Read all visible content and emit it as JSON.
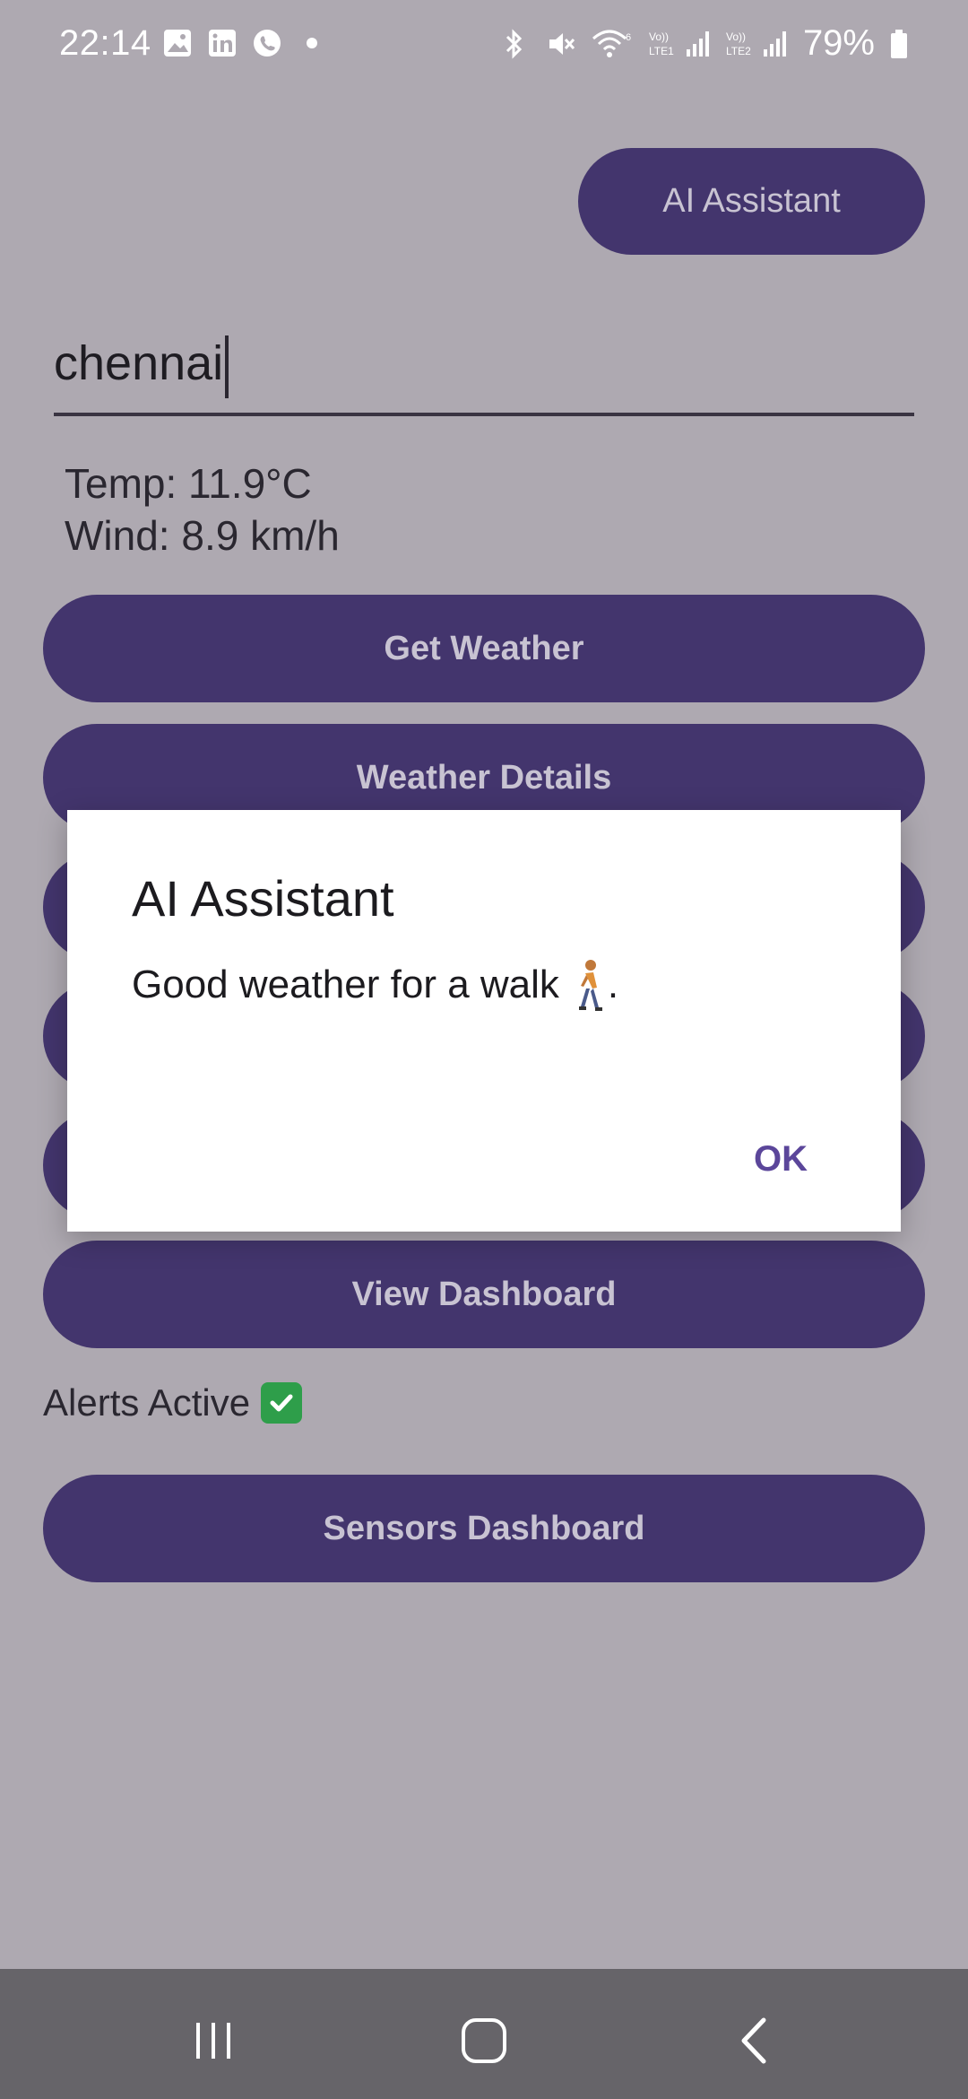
{
  "status_bar": {
    "time": "22:14",
    "left_icons": [
      "gallery-icon",
      "linkedin-icon",
      "whatsapp-icon",
      "dot-icon"
    ],
    "right_icons": [
      "bluetooth-icon",
      "mute-icon",
      "wifi-icon",
      "signal-lte1-icon",
      "signal-lte2-icon",
      "battery-icon"
    ],
    "battery": "79%"
  },
  "header": {
    "ai_button_label": "AI Assistant"
  },
  "city_input": {
    "value": "chennai"
  },
  "weather": {
    "temp": "Temp: 11.9°C",
    "wind": "Wind: 8.9 km/h"
  },
  "buttons": {
    "get_weather": "Get Weather",
    "weather_details": "Weather Details",
    "view_dashboard": "View Dashboard",
    "sensors_dashboard": "Sensors Dashboard"
  },
  "alerts": {
    "label": "Alerts Active"
  },
  "dialog": {
    "title": "AI Assistant",
    "message": "Good weather for a walk",
    "message_end": ".",
    "ok_label": "OK"
  },
  "nav": [
    "recent-apps-icon",
    "home-icon",
    "back-icon"
  ],
  "colors": {
    "background": "#aea9b1",
    "button": "#43356d",
    "button_text": "#c8c3d2",
    "dialog_accent": "#5b469a",
    "nav_bar": "#666469"
  }
}
